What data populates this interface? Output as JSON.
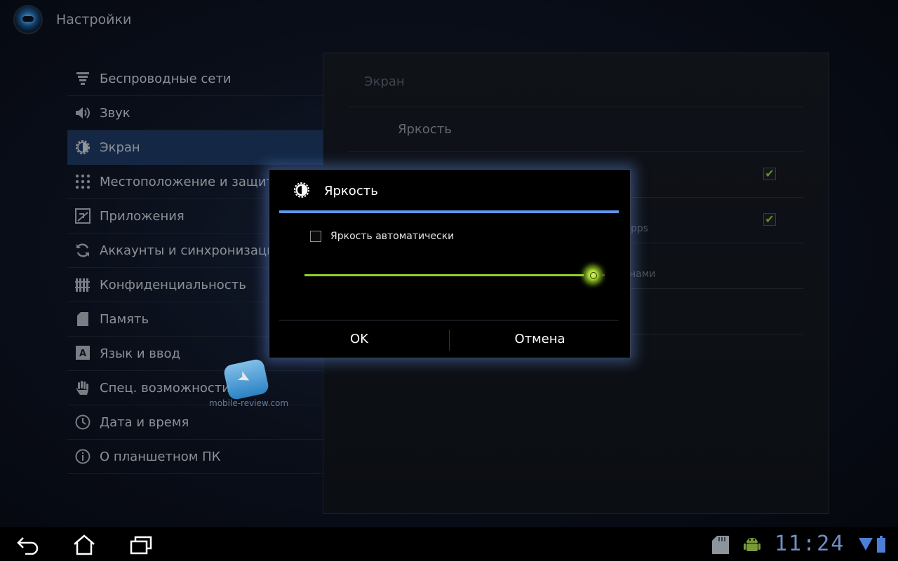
{
  "app": {
    "title": "Настройки"
  },
  "menu": {
    "items": [
      {
        "label": "Беспроводные сети",
        "icon": "wifi-signal-icon"
      },
      {
        "label": "Звук",
        "icon": "speaker-icon"
      },
      {
        "label": "Экран",
        "icon": "brightness-icon",
        "selected": true
      },
      {
        "label": "Местоположение и защита",
        "icon": "location-grid-icon"
      },
      {
        "label": "Приложения",
        "icon": "apps-icon"
      },
      {
        "label": "Аккаунты и синхронизация",
        "icon": "sync-icon"
      },
      {
        "label": "Конфиденциальность",
        "icon": "privacy-fence-icon"
      },
      {
        "label": "Память",
        "icon": "sd-card-icon"
      },
      {
        "label": "Язык и ввод",
        "icon": "keyboard-letter-icon"
      },
      {
        "label": "Спец. возможности",
        "icon": "hand-icon"
      },
      {
        "label": "Дата и время",
        "icon": "clock-icon"
      },
      {
        "label": "О планшетном ПК",
        "icon": "info-icon"
      }
    ]
  },
  "panel": {
    "header": "Экран",
    "brightness_row": "Яркость",
    "partial_sub_1": "pps",
    "partial_sub_2": "нами",
    "check1": true,
    "check2": true
  },
  "dialog": {
    "title": "Яркость",
    "auto_brightness_label": "Яркость автоматически",
    "auto_brightness_checked": false,
    "brightness_level": 0.96,
    "ok_label": "OK",
    "cancel_label": "Отмена"
  },
  "watermark": {
    "text": "mobile-review.com"
  },
  "system_bar": {
    "time": "11:24"
  },
  "colors": {
    "accent": "#5f95e8",
    "selected": "#1e3a64",
    "slider": "#8ed02a"
  }
}
